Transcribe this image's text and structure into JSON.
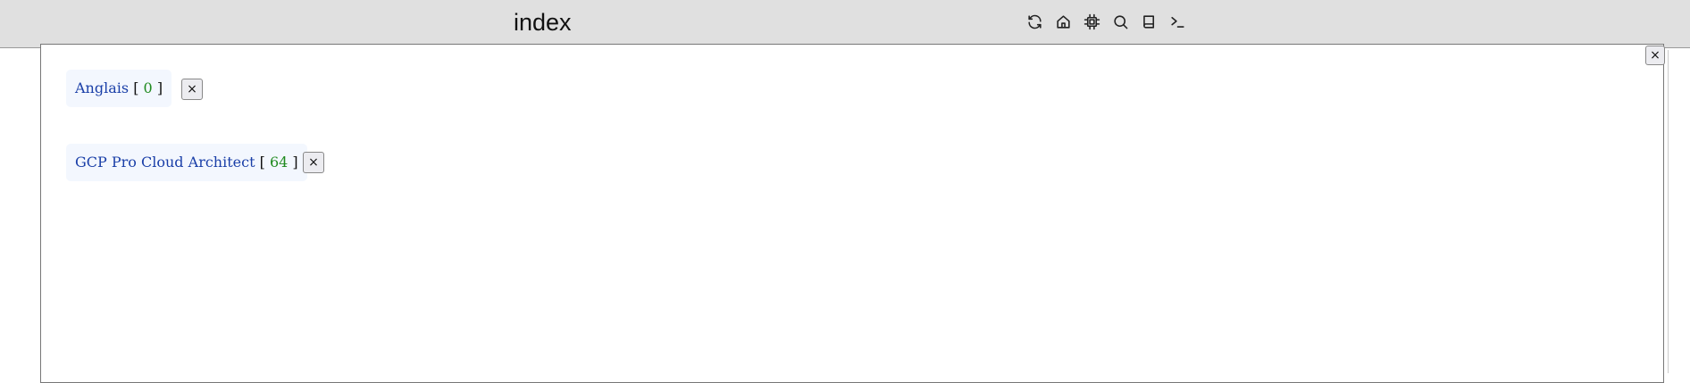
{
  "header": {
    "title": "index",
    "icons": [
      "refresh-icon",
      "home-icon",
      "chip-icon",
      "search-icon",
      "book-icon",
      "terminal-icon"
    ]
  },
  "panel": {
    "close_label": "×"
  },
  "items": [
    {
      "name": "Anglais",
      "count": "0",
      "open": "[",
      "close": "]",
      "remove_label": "×"
    },
    {
      "name": "GCP Pro Cloud Architect",
      "count": "64",
      "open": "[",
      "close": "]",
      "remove_label": "×"
    }
  ],
  "colors": {
    "link": "#1a3fa8",
    "count": "#1f8a1f",
    "header_bg": "#e0e0e0",
    "tag_bg": "#f3f7fe"
  }
}
